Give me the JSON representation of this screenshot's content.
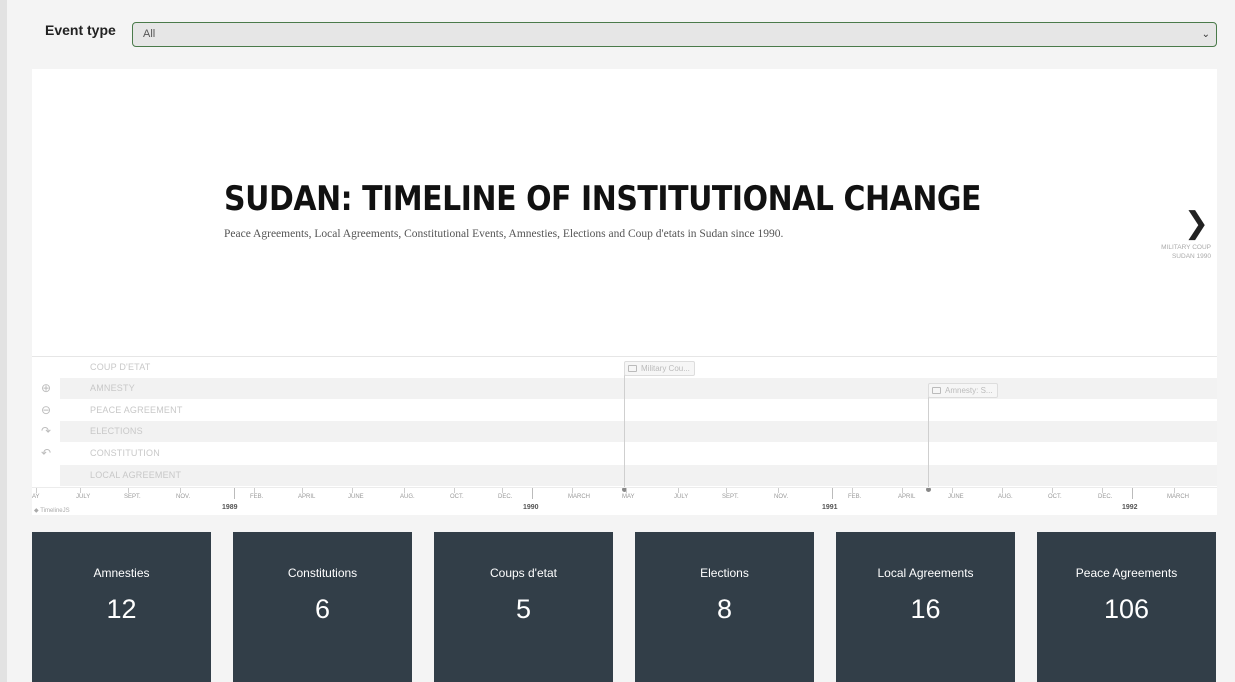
{
  "filter": {
    "label": "Event type",
    "selected": "All"
  },
  "slide": {
    "title": "SUDAN: TIMELINE OF INSTITUTIONAL CHANGE",
    "subtitle": "Peace Agreements, Local Agreements, Constitutional Events, Amnesties, Elections and Coup d'etats in Sudan since 1990.",
    "next_line1": "MILITARY COUP",
    "next_line2": "SUDAN 1990"
  },
  "tracks": [
    "COUP D'ETAT",
    "AMNESTY",
    "PEACE AGREEMENT",
    "ELECTIONS",
    "CONSTITUTION",
    "LOCAL AGREEMENT"
  ],
  "events": [
    {
      "label": "Military Cou..."
    },
    {
      "label": "Amnesty: S..."
    }
  ],
  "axis": {
    "months": [
      "AY",
      "JULY",
      "SEPT.",
      "NOV.",
      "FEB.",
      "APRIL",
      "JUNE",
      "AUG.",
      "OCT.",
      "DEC.",
      "MARCH",
      "MAY",
      "JULY",
      "SEPT.",
      "NOV.",
      "FEB.",
      "APRIL",
      "JUNE",
      "AUG.",
      "OCT.",
      "DEC.",
      "MARCH"
    ],
    "years": [
      "1989",
      "1990",
      "1991",
      "1992"
    ],
    "credit": "TimelineJS"
  },
  "stats": [
    {
      "label": "Amnesties",
      "value": "12"
    },
    {
      "label": "Constitutions",
      "value": "6"
    },
    {
      "label": "Coups d'etat",
      "value": "5"
    },
    {
      "label": "Elections",
      "value": "8"
    },
    {
      "label": "Local Agreements",
      "value": "16"
    },
    {
      "label": "Peace Agreements",
      "value": "106"
    }
  ],
  "colors": {
    "card_bg": "#323e48",
    "select_border": "#4a7a4a"
  }
}
